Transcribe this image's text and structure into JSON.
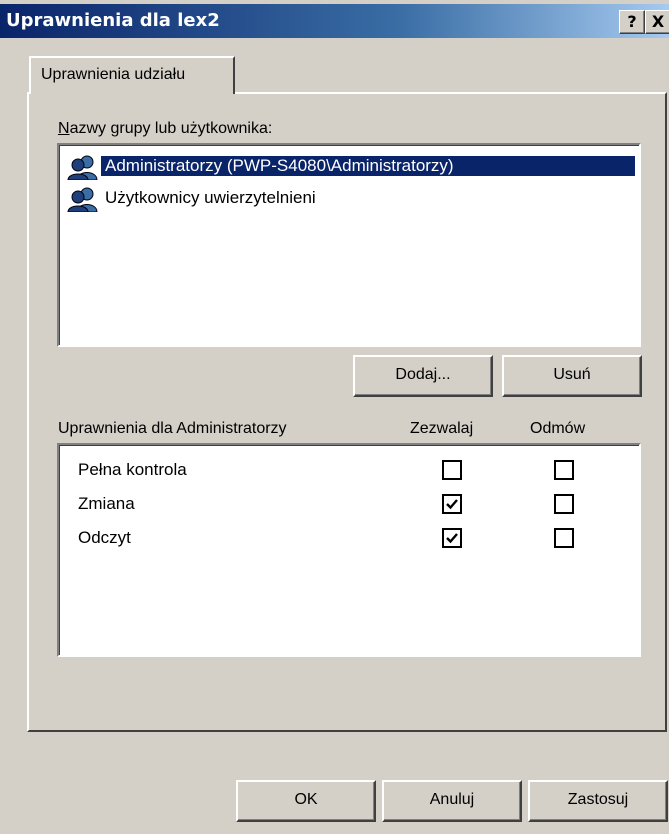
{
  "window": {
    "title": "Uprawnienia dla lex2",
    "help_button": "?",
    "close_button": "X"
  },
  "tabs": [
    {
      "label": "Uprawnienia udziału"
    }
  ],
  "group_list": {
    "label": "Nazwy grupy lub użytkownika:",
    "items": [
      {
        "name": "Administratorzy (PWP-S4080\\Administratorzy)",
        "selected": true,
        "icon": "users-group-icon"
      },
      {
        "name": "Użytkownicy uwierzytelnieni",
        "selected": false,
        "icon": "users-group-icon"
      }
    ]
  },
  "buttons": {
    "add": "Dodaj...",
    "remove": "Usuń"
  },
  "permissions": {
    "label": "Uprawnienia dla Administratorzy",
    "col_allow": "Zezwalaj",
    "col_deny": "Odmów",
    "rows": [
      {
        "name": "Pełna kontrola",
        "allow": false,
        "deny": false
      },
      {
        "name": "Zmiana",
        "allow": true,
        "deny": false
      },
      {
        "name": "Odczyt",
        "allow": true,
        "deny": false
      }
    ]
  },
  "footer": {
    "ok": "OK",
    "cancel": "Anuluj",
    "apply": "Zastosuj"
  }
}
